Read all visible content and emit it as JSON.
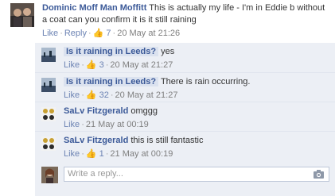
{
  "top_comment": {
    "author": "Dominic Moff Man Moffitt",
    "text": "This is actually my life - I'm in Eddie b without a coat can you confirm it is it still raining",
    "like_label": "Like",
    "reply_label": "Reply",
    "like_count": "7",
    "timestamp": "20 May at 21:26"
  },
  "replies": [
    {
      "author": "Is it raining in Leeds?",
      "text": "yes",
      "like_label": "Like",
      "like_count": "3",
      "timestamp": "20 May at 21:27"
    },
    {
      "author": "Is it raining in Leeds?",
      "text": "There is rain occurring.",
      "like_label": "Like",
      "like_count": "32",
      "timestamp": "20 May at 21:27"
    },
    {
      "author": "SaLv Fitzgerald",
      "text": "omggg",
      "like_label": "Like",
      "like_count": "",
      "timestamp": "21 May at 00:19"
    },
    {
      "author": "SaLv Fitzgerald",
      "text": "this is still fantastic",
      "like_label": "Like",
      "like_count": "1",
      "timestamp": "21 May at 00:19"
    }
  ],
  "write_reply": {
    "placeholder": "Write a reply..."
  },
  "colors": {
    "link_blue": "#3b5998",
    "reply_bg": "#eceff5",
    "page_name_bg": "#dbe2ef"
  },
  "icons": {
    "like": "thumbs-up-icon",
    "camera": "camera-icon"
  }
}
